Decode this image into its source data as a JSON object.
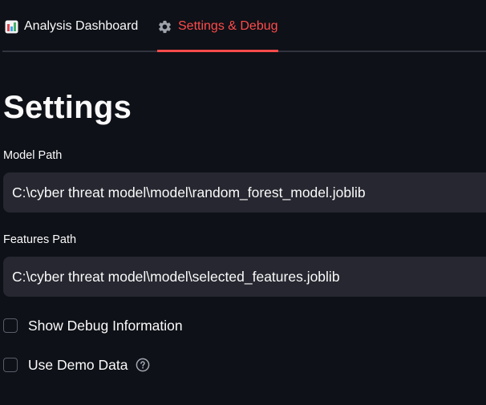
{
  "tabs": [
    {
      "label": "Analysis Dashboard",
      "icon": "bar-chart-icon",
      "active": false
    },
    {
      "label": "Settings & Debug",
      "icon": "gear-icon",
      "active": true
    }
  ],
  "page": {
    "title": "Settings"
  },
  "fields": {
    "model_path": {
      "label": "Model Path",
      "value": "C:\\cyber threat model\\model\\random_forest_model.joblib"
    },
    "features_path": {
      "label": "Features Path",
      "value": "C:\\cyber threat model\\model\\selected_features.joblib"
    }
  },
  "checkboxes": {
    "show_debug": {
      "label": "Show Debug Information",
      "checked": false
    },
    "use_demo": {
      "label": "Use Demo Data",
      "checked": false,
      "help_icon": "help-circle-icon"
    }
  },
  "colors": {
    "background": "#0e1117",
    "accent": "#ff4b4b",
    "input_background": "#262730",
    "text": "#fafafa"
  }
}
